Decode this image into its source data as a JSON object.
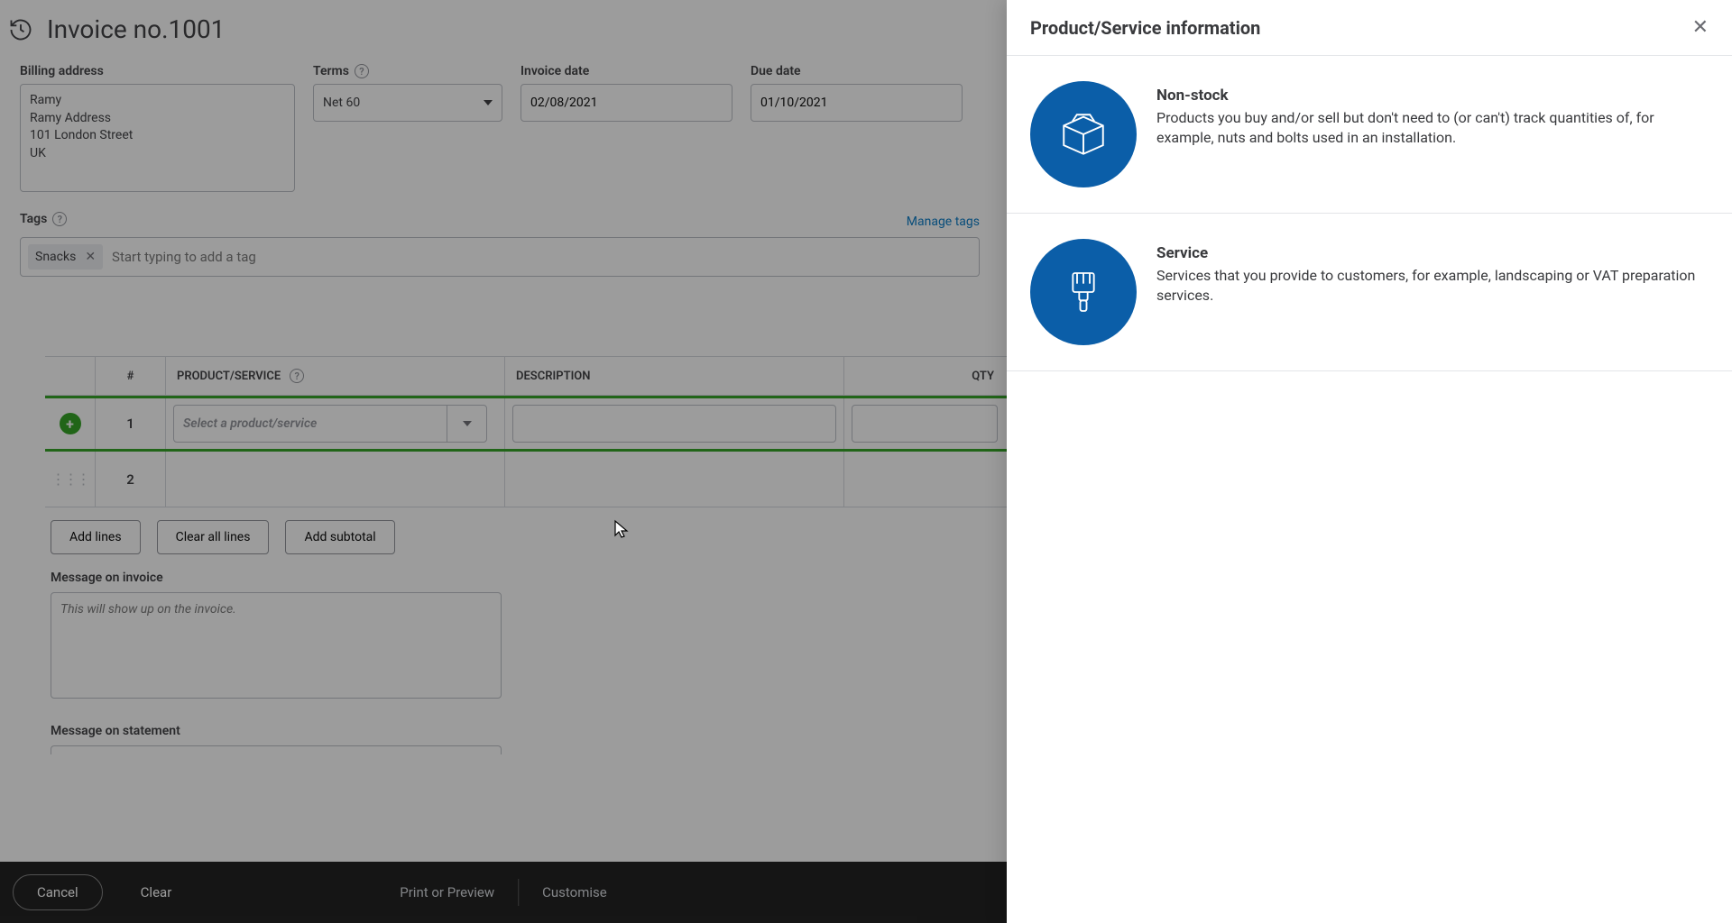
{
  "header": {
    "title": "Invoice no.1001"
  },
  "labels": {
    "billing": "Billing address",
    "terms": "Terms",
    "invoice_date": "Invoice date",
    "due_date": "Due date",
    "tags": "Tags",
    "manage_tags": "Manage tags",
    "msg_invoice": "Message on invoice",
    "msg_statement": "Message on statement"
  },
  "fields": {
    "billing_address": "Ramy\nRamy Address\n101 London Street\nUK",
    "terms_value": "Net 60",
    "invoice_date": "02/08/2021",
    "due_date": "01/10/2021",
    "tag_chip": "Snacks",
    "tag_placeholder": "Start typing to add a tag",
    "product_placeholder": "Select a product/service",
    "msg_invoice_placeholder": "This will show up on the invoice."
  },
  "table": {
    "cols": {
      "num": "#",
      "product": "PRODUCT/SERVICE",
      "desc": "DESCRIPTION",
      "qty": "QTY"
    },
    "rows": [
      {
        "n": "1"
      },
      {
        "n": "2"
      }
    ]
  },
  "buttons": {
    "add_lines": "Add lines",
    "clear_all": "Clear all lines",
    "add_subtotal": "Add subtotal"
  },
  "footer": {
    "cancel": "Cancel",
    "clear": "Clear",
    "print": "Print or Preview",
    "customise": "Customise"
  },
  "panel": {
    "title": "Product/Service information",
    "opts": [
      {
        "title": "Non-stock",
        "desc": "Products you buy and/or sell but don't need to (or can't) track quantities of, for example, nuts and bolts used in an installation."
      },
      {
        "title": "Service",
        "desc": "Services that you provide to customers, for example, landscaping or VAT preparation services."
      }
    ]
  }
}
